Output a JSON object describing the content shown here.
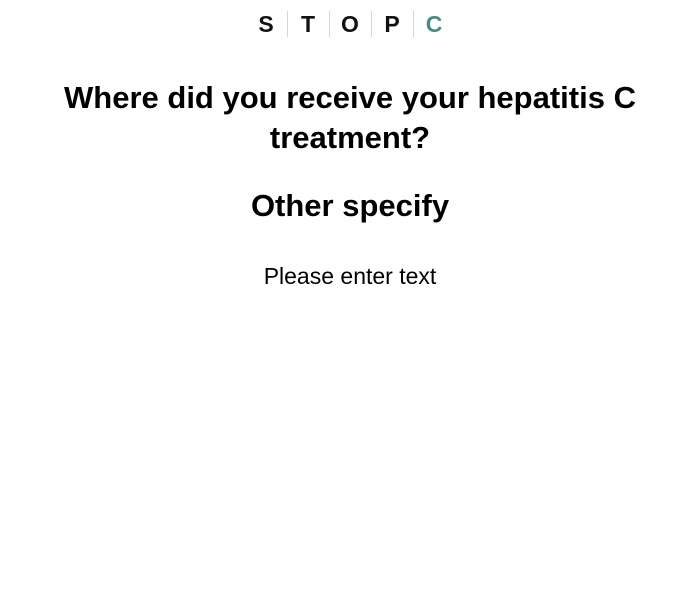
{
  "logo": {
    "letters": [
      "S",
      "T",
      "O",
      "P",
      "C"
    ],
    "accent_color": "#4b8a80"
  },
  "question": {
    "text": "Where did you receive your hepatitis C treatment?"
  },
  "subtitle": {
    "text": "Other specify"
  },
  "input": {
    "value": "",
    "placeholder": "Please enter text"
  }
}
